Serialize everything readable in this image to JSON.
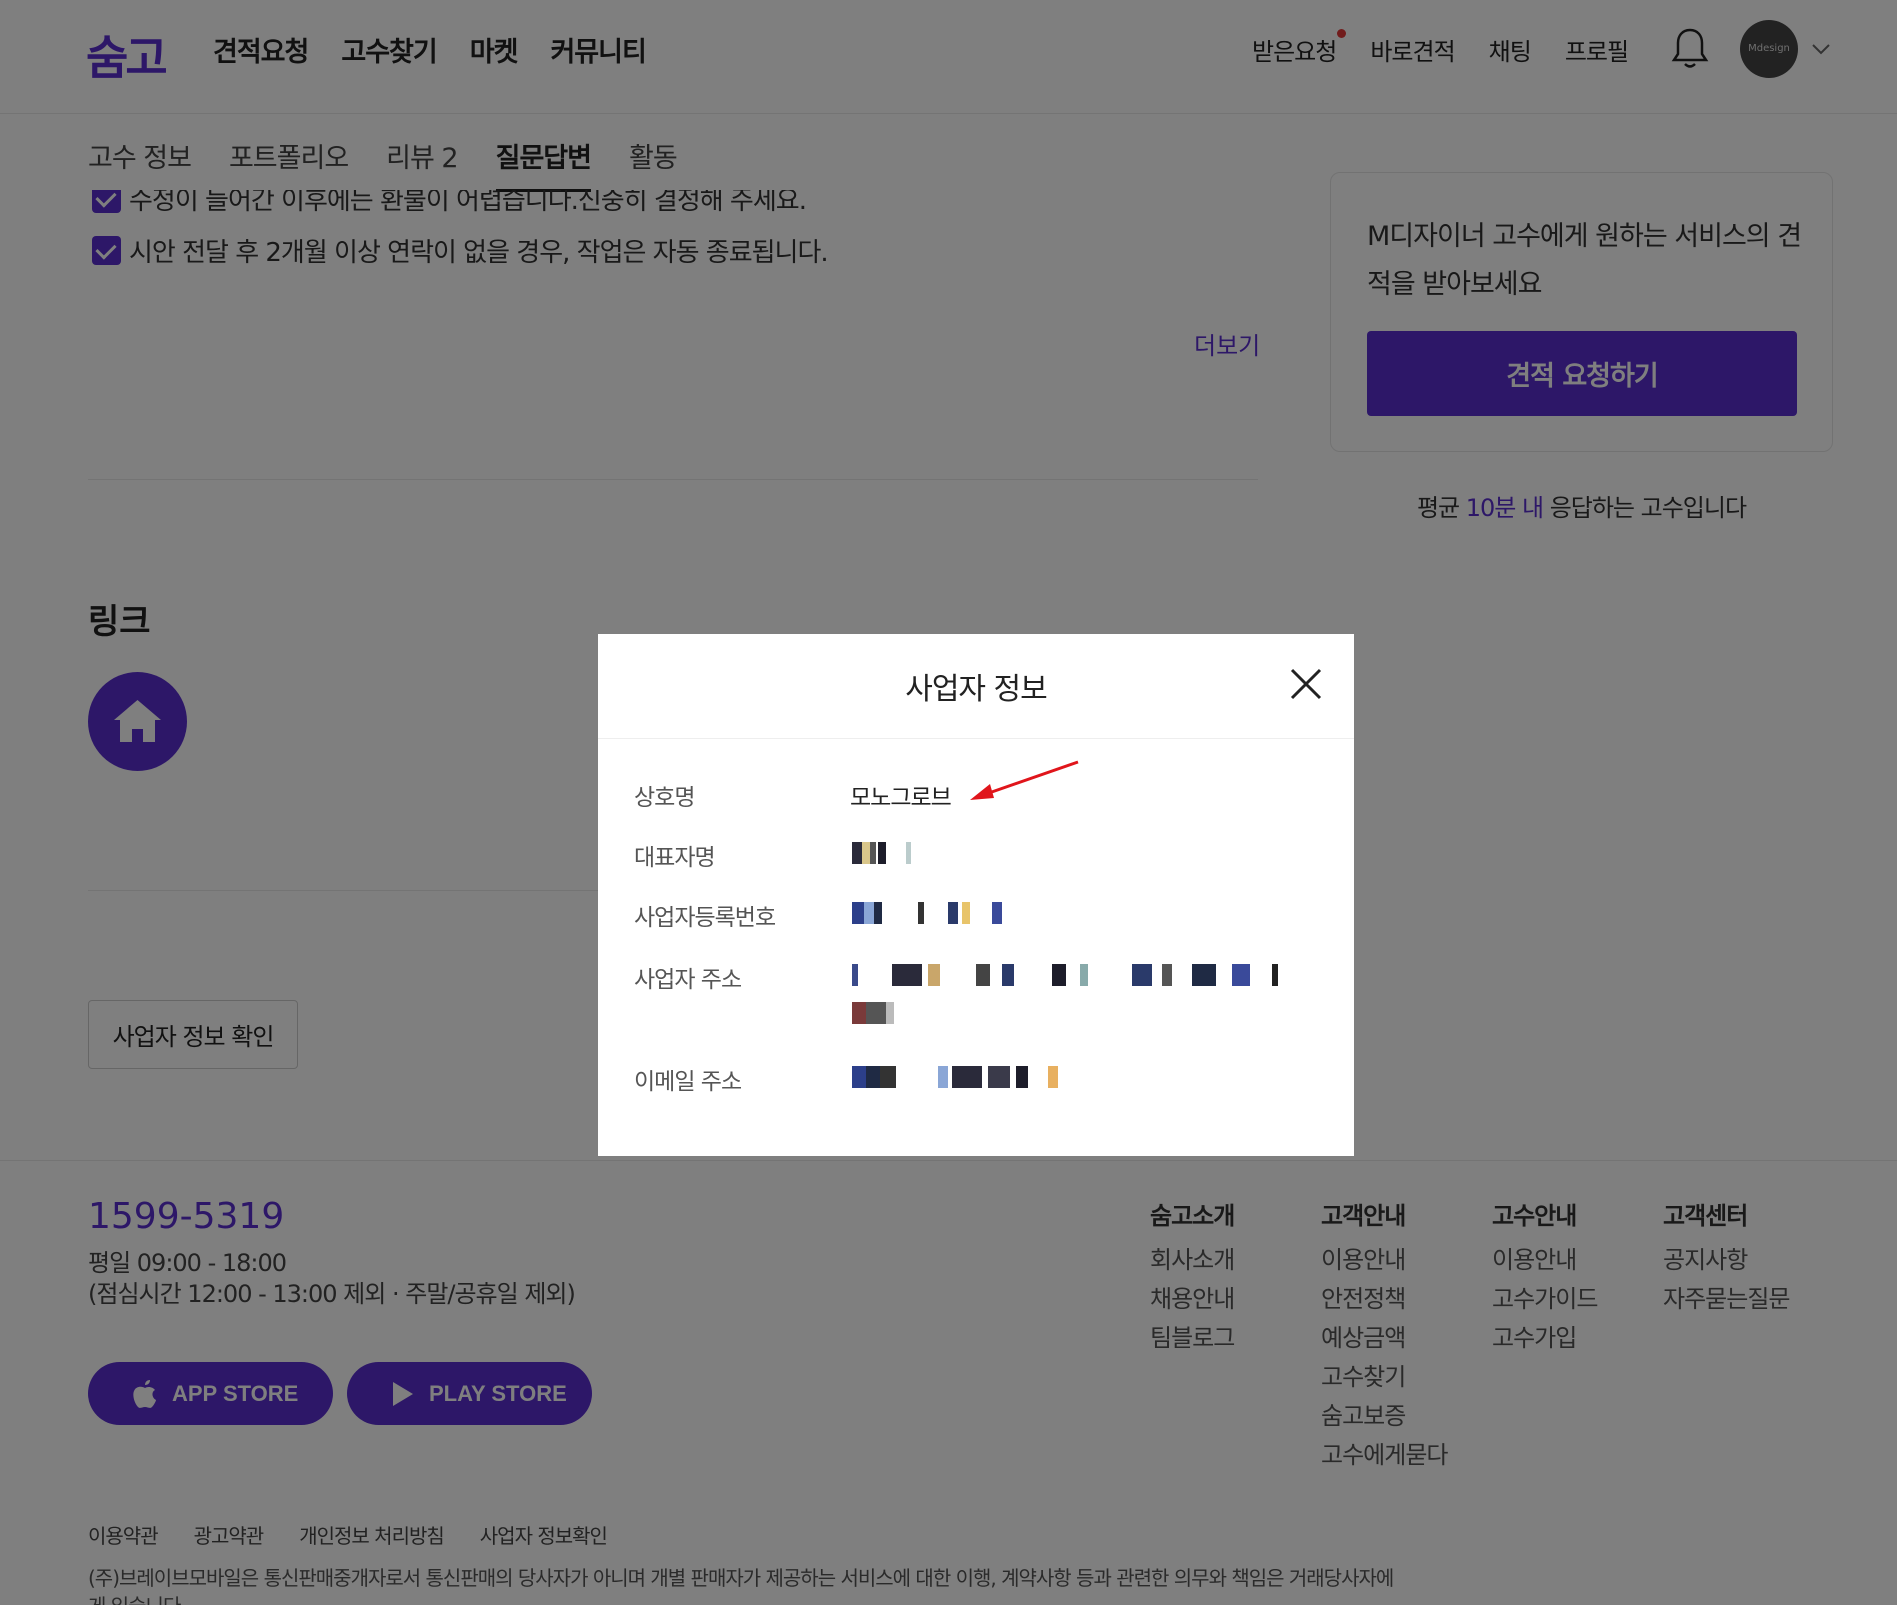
{
  "header": {
    "logo": "숨고",
    "nav": [
      "견적요청",
      "고수찾기",
      "마켓",
      "커뮤니티"
    ],
    "user_nav": [
      "받은요청",
      "바로견적",
      "채팅",
      "프로필"
    ],
    "avatar_text": "Mdesign"
  },
  "tabs": [
    {
      "label": "고수 정보",
      "active": false
    },
    {
      "label": "포트폴리오",
      "active": false
    },
    {
      "label": "리뷰 2",
      "active": false
    },
    {
      "label": "질문답변",
      "active": true
    },
    {
      "label": "활동",
      "active": false
    }
  ],
  "content": {
    "policy_partial": "수정이 들어간 이후에는 환불이 어렵습니다.신중히 결정해 주세요.",
    "policy_last": "시안 전달 후 2개월 이상 연락이 없을 경우, 작업은 자동 종료됩니다.",
    "more_label": "더보기",
    "links_title": "링크",
    "biz_button": "사업자 정보 확인"
  },
  "sidebar": {
    "card_text": "M디자이너 고수에게 원하는 서비스의 견적을 받아보세요",
    "cta": "견적 요청하기",
    "response_prefix": "평균 ",
    "response_highlight": "10분 내",
    "response_suffix": " 응답하는 고수입니다"
  },
  "modal": {
    "title": "사업자 정보",
    "rows": [
      {
        "label": "상호명",
        "value": "모노그로브"
      },
      {
        "label": "대표자명",
        "value": ""
      },
      {
        "label": "사업자등록번호",
        "value": ""
      },
      {
        "label": "사업자 주소",
        "value": ""
      },
      {
        "label": "이메일 주소",
        "value": ""
      }
    ]
  },
  "footer": {
    "phone": "1599-5319",
    "hours_line1": "평일 09:00 - 18:00",
    "hours_line2": "(점심시간 12:00 - 13:00 제외 · 주말/공휴일 제외)",
    "app_store": "APP STORE",
    "play_store": "PLAY STORE",
    "columns": [
      {
        "title": "숨고소개",
        "items": [
          "회사소개",
          "채용안내",
          "팀블로그"
        ]
      },
      {
        "title": "고객안내",
        "items": [
          "이용안내",
          "안전정책",
          "예상금액",
          "고수찾기",
          "숨고보증",
          "고수에게묻다"
        ]
      },
      {
        "title": "고수안내",
        "items": [
          "이용안내",
          "고수가이드",
          "고수가입"
        ]
      },
      {
        "title": "고객센터",
        "items": [
          "공지사항",
          "자주묻는질문"
        ]
      }
    ],
    "links": [
      "이용약관",
      "광고약관",
      "개인정보 처리방침",
      "사업자 정보확인"
    ],
    "note": "(주)브레이브모바일은 통신판매중개자로서 통신판매의 당사자가 아니며 개별 판매자가 제공하는 서비스에 대한 이행, 계약사항 등과 관련한 의무와 책임은 거래당사자에게 있습니다."
  },
  "colors": {
    "brand": "#5a2fd0",
    "alert_dot": "#e23838",
    "overlay": "rgba(0,0,0,0.5)"
  }
}
